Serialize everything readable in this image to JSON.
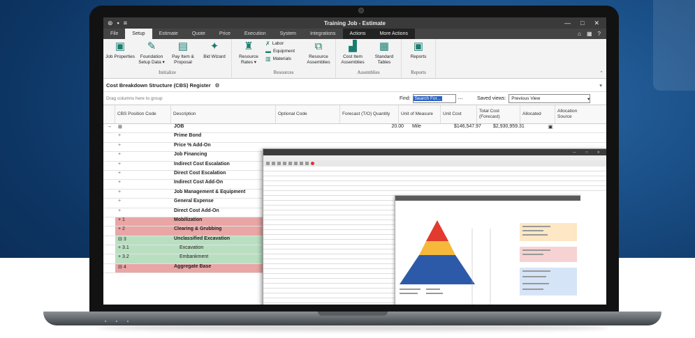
{
  "window": {
    "title": "Training Job - Estimate",
    "controls": [
      "—",
      "□",
      "✕"
    ]
  },
  "menu": {
    "items": [
      "File",
      "Setup",
      "Estimate",
      "Quote",
      "Price",
      "Execution",
      "System",
      "Integrations",
      "Actions",
      "More Actions"
    ],
    "active": "Setup"
  },
  "ribbon": {
    "groups": [
      {
        "label": "Initialize",
        "buttons": [
          "Job Properties",
          "Foundation Setup Data ▾",
          "Pay Item & Proposal",
          "Bid Wizard"
        ]
      },
      {
        "label": "Resources",
        "buttons": [
          "Resource Rates ▾"
        ],
        "small": [
          "Labor",
          "Equipment",
          "Materials"
        ],
        "extra": [
          "Resource Assemblies"
        ]
      },
      {
        "label": "Assemblies",
        "buttons": [
          "Cost Item Assemblies",
          "Standard Tables"
        ]
      },
      {
        "label": "Reports",
        "buttons": [
          "Reports"
        ]
      }
    ]
  },
  "register": {
    "tab_label": "Cost Breakdown Structure (CBS) Register",
    "group_hint": "Drag columns here to group",
    "find_label": "Find:",
    "find_placeholder": "Search For...",
    "saved_views_label": "Saved views:",
    "saved_view_value": "Previous View"
  },
  "grid": {
    "headers": [
      "CBS Position Code",
      "Description",
      "Optional Code",
      "Forecast (T/O) Quantity",
      "Unit of Measure",
      "Unit Cost",
      "Total Cost (Forecast)",
      "Allocated",
      "Allocation Source"
    ],
    "job_row": {
      "quantity": "20.00",
      "unit": "Mile",
      "unit_cost": "$146,547.97",
      "total": "$2,930,959.31"
    },
    "rows": [
      {
        "code": "",
        "desc": "JOB",
        "style": "job"
      },
      {
        "code": "",
        "desc": "Prime Bond",
        "style": "plain"
      },
      {
        "code": "",
        "desc": "Price % Add-On",
        "style": "plain"
      },
      {
        "code": "",
        "desc": "Job Financing",
        "style": "plain"
      },
      {
        "code": "",
        "desc": "Indirect Cost Escalation",
        "style": "plain"
      },
      {
        "code": "",
        "desc": "Direct Cost Escalation",
        "style": "plain"
      },
      {
        "code": "",
        "desc": "Indirect Cost Add-On",
        "style": "plain"
      },
      {
        "code": "",
        "desc": "Job Management & Equipment",
        "style": "plain"
      },
      {
        "code": "",
        "desc": "General Expense",
        "style": "plain"
      },
      {
        "code": "",
        "desc": "Direct Cost Add-On",
        "style": "plain"
      },
      {
        "code": "1",
        "desc": "Mobilization",
        "style": "red"
      },
      {
        "code": "2",
        "desc": "Clearing & Grubbing",
        "style": "red"
      },
      {
        "code": "3",
        "desc": "Unclassified Excavation",
        "style": "green"
      },
      {
        "code": "3.1",
        "desc": "Excavation",
        "style": "green-sub"
      },
      {
        "code": "3.2",
        "desc": "Embankment",
        "style": "green-sub"
      },
      {
        "code": "4",
        "desc": "Aggregate Base",
        "style": "red"
      }
    ]
  },
  "colors": {
    "accent": "#1b7d70",
    "red_row": "#eaa5a5",
    "green_row": "#b9dfc1"
  }
}
